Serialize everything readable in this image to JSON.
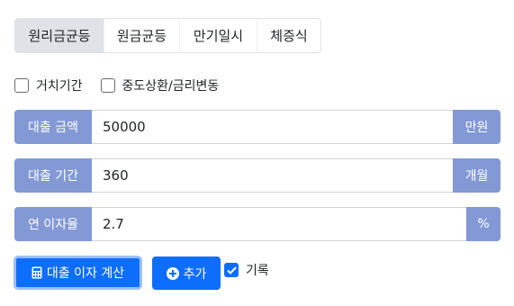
{
  "tabs": [
    {
      "label": "원리금균등",
      "active": true
    },
    {
      "label": "원금균등",
      "active": false
    },
    {
      "label": "만기일시",
      "active": false
    },
    {
      "label": "체증식",
      "active": false
    }
  ],
  "options": [
    {
      "label": "거치기간",
      "checked": false
    },
    {
      "label": "중도상환/금리변동",
      "checked": false
    }
  ],
  "inputs": {
    "amount": {
      "prefix": "대출 금액",
      "value": "50000",
      "suffix": "만원"
    },
    "period": {
      "prefix": "대출 기간",
      "value": "360",
      "suffix": "개월"
    },
    "rate": {
      "prefix": "연 이자율",
      "value": "2.7",
      "suffix": "%"
    }
  },
  "actions": {
    "calculate": {
      "label": "대출 이자 계산",
      "icon": "calculator-icon"
    },
    "add": {
      "label": "추가",
      "icon": "plus-circle-icon"
    },
    "record": {
      "label": "기록",
      "checked": true
    }
  },
  "colors": {
    "primary": "#0d6efd",
    "addon": "#8399d6",
    "tab_active": "#dfe3e8"
  }
}
